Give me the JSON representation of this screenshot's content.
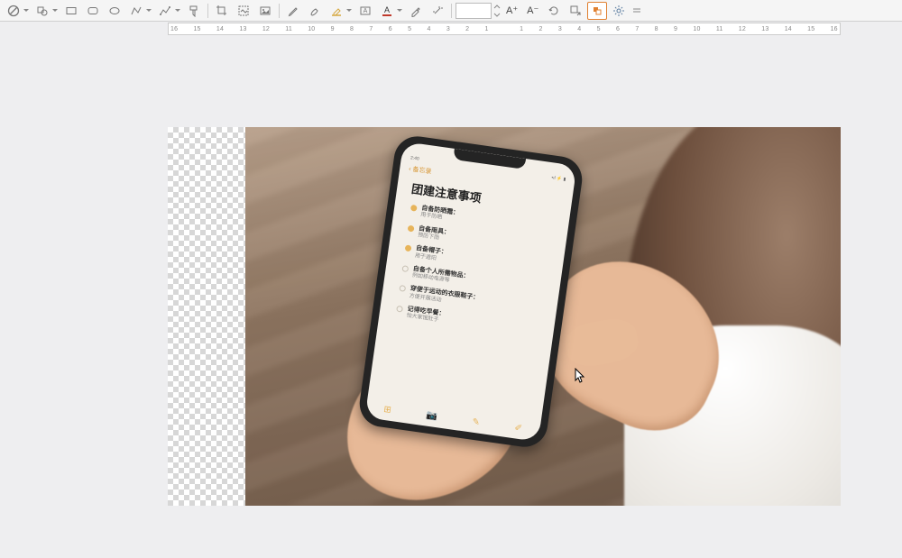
{
  "toolbar": {
    "font_size_value": "",
    "increase_font": "A⁺",
    "decrease_font": "A⁻"
  },
  "ruler": {
    "marks": [
      "16",
      "15",
      "14",
      "13",
      "12",
      "11",
      "10",
      "9",
      "8",
      "7",
      "6",
      "5",
      "4",
      "3",
      "2",
      "1",
      "",
      "1",
      "2",
      "3",
      "4",
      "5",
      "6",
      "7",
      "8",
      "9",
      "10",
      "11",
      "12",
      "13",
      "14",
      "15",
      "16"
    ]
  },
  "phone": {
    "time": "2:40",
    "signal": "•ıl ⚡ ▮",
    "back_label": "‹ 备忘录",
    "title": "团建注意事项",
    "items": [
      {
        "bold": "自备防晒霜：",
        "sub": "用于防晒",
        "done": true
      },
      {
        "bold": "自备雨具：",
        "sub": "预防下雨",
        "done": true
      },
      {
        "bold": "自备帽子：",
        "sub": "用于遮阳",
        "done": true
      },
      {
        "bold": "自备个人所需物品：",
        "sub": "例如移动电源等",
        "done": false
      },
      {
        "bold": "穿便于运动的衣服鞋子：",
        "sub": "方便开展活动",
        "done": false
      },
      {
        "bold": "记得吃早餐：",
        "sub": "怕大家饿肚子",
        "done": false
      }
    ]
  }
}
